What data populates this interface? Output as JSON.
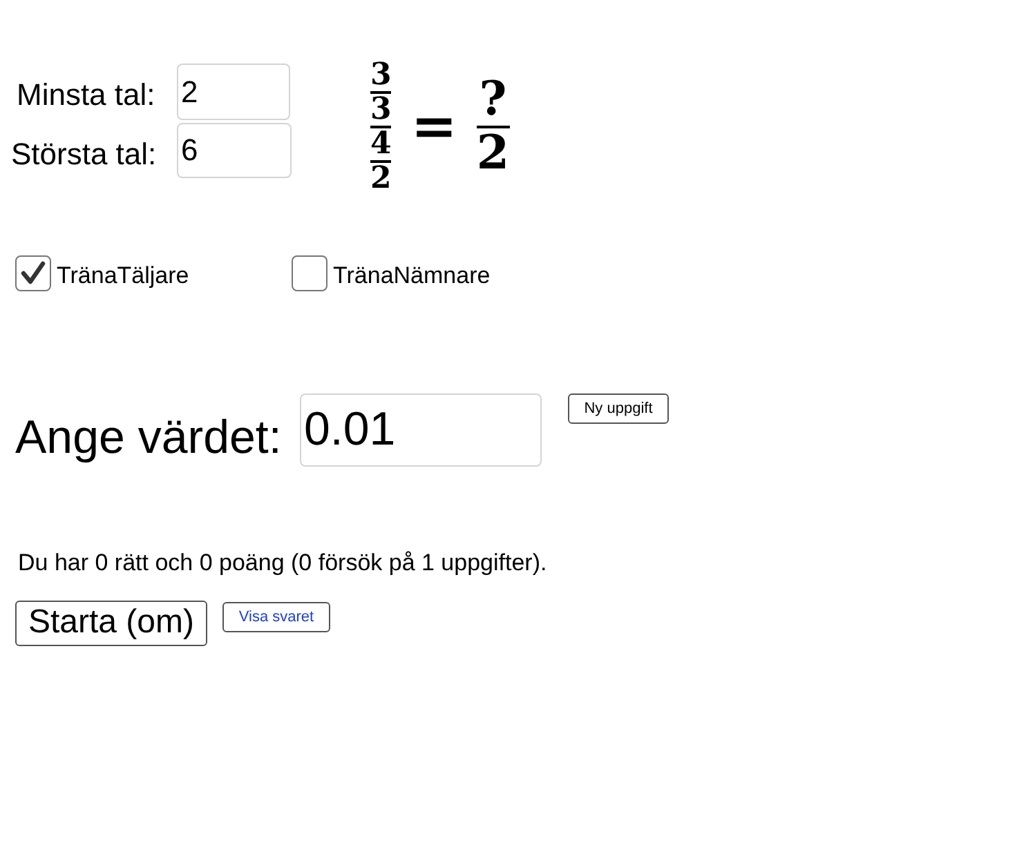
{
  "range_fields": [
    {
      "label": "Minsta tal:",
      "value": "2"
    },
    {
      "label": "Största tal:",
      "value": "6"
    }
  ],
  "formula": {
    "lhs": {
      "numerator": {
        "numerator": "3",
        "denominator": "3"
      },
      "denominator": {
        "numerator": "4",
        "denominator": "2"
      }
    },
    "equals": "=",
    "rhs": {
      "numerator": "?",
      "denominator": "2"
    }
  },
  "checkboxes": [
    {
      "label": "TränaTäljare",
      "checked": true
    },
    {
      "label": "TränaNämnare",
      "checked": false
    }
  ],
  "answer": {
    "label": "Ange värdet:",
    "value": "0.01"
  },
  "new_task_button": "Ny uppgift",
  "score_text": "Du har 0 rätt och 0 poäng (0 försök på 1 uppgifter).",
  "restart_button": "Starta (om)",
  "show_answer_button": "Visa svaret"
}
